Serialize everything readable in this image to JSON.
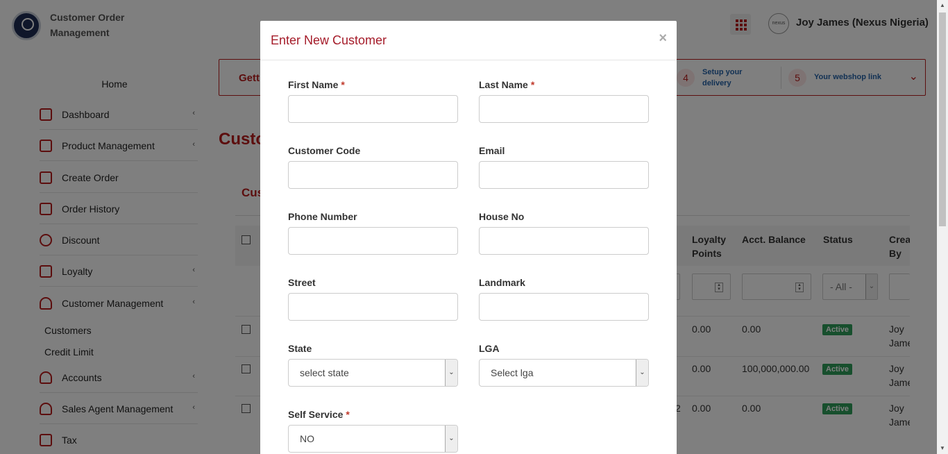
{
  "app": {
    "title": "Customer Order Management"
  },
  "user": {
    "name": "Joy James (Nexus Nigeria)",
    "avatar_text": "nexus"
  },
  "sidebar": {
    "home": "Home",
    "items": [
      {
        "label": "Dashboard",
        "icon": "bar-chart-icon",
        "has_submenu": true
      },
      {
        "label": "Product Management",
        "icon": "tag-icon",
        "has_submenu": true
      },
      {
        "label": "Create Order",
        "icon": "cart-icon",
        "has_submenu": false
      },
      {
        "label": "Order History",
        "icon": "history-icon",
        "has_submenu": false
      },
      {
        "label": "Discount",
        "icon": "discount-icon",
        "has_submenu": false
      },
      {
        "label": "Loyalty",
        "icon": "gift-icon",
        "has_submenu": true
      },
      {
        "label": "Customer Management",
        "icon": "users-icon",
        "has_submenu": true
      },
      {
        "label": "Accounts",
        "icon": "users-icon",
        "has_submenu": true
      },
      {
        "label": "Sales Agent Management",
        "icon": "user-check-icon",
        "has_submenu": true
      },
      {
        "label": "Tax",
        "icon": "percent-icon",
        "has_submenu": false
      }
    ],
    "sub_items": [
      "Customers",
      "Credit Limit"
    ],
    "chevron": "‹"
  },
  "steps": {
    "getting_started": "Getti",
    "items": [
      {
        "num": "4",
        "label": "Setup your delivery"
      },
      {
        "num": "5",
        "label": "Your webshop link"
      }
    ]
  },
  "page": {
    "title": "Custo",
    "card_title": "Cus"
  },
  "table": {
    "headers": [
      "Loyalty Points",
      "Acct. Balance",
      "Status",
      "Crea By"
    ],
    "status_filter": "- All -",
    "rows": [
      {
        "hidden_frag": "",
        "loyalty": "0.00",
        "balance": "0.00",
        "status": "Active",
        "created_by": "Joy Jame"
      },
      {
        "hidden_frag": "",
        "loyalty": "0.00",
        "balance": "100,000,000.00",
        "status": "Active",
        "created_by": "Joy Jame"
      },
      {
        "hidden_frag": "2",
        "loyalty": "0.00",
        "balance": "0.00",
        "status": "Active",
        "created_by": "Joy Jame"
      }
    ]
  },
  "modal": {
    "title": "Enter New Customer",
    "close": "×",
    "fields": {
      "first_name": {
        "label": "First Name",
        "required": "*",
        "value": ""
      },
      "last_name": {
        "label": "Last Name",
        "required": "*",
        "value": ""
      },
      "customer_code": {
        "label": "Customer Code",
        "value": ""
      },
      "email": {
        "label": "Email",
        "value": ""
      },
      "phone": {
        "label": "Phone Number",
        "value": ""
      },
      "house_no": {
        "label": "House No",
        "value": ""
      },
      "street": {
        "label": "Street",
        "value": ""
      },
      "landmark": {
        "label": "Landmark",
        "value": ""
      },
      "state": {
        "label": "State",
        "selected": "select state"
      },
      "lga": {
        "label": "LGA",
        "selected": "Select lga"
      },
      "self_service": {
        "label": "Self Service",
        "required": "*",
        "selected": "NO"
      }
    }
  },
  "colors": {
    "accent": "#b91c1c",
    "modal_title": "#a51c2a",
    "status_active": "#2e9e5b"
  }
}
